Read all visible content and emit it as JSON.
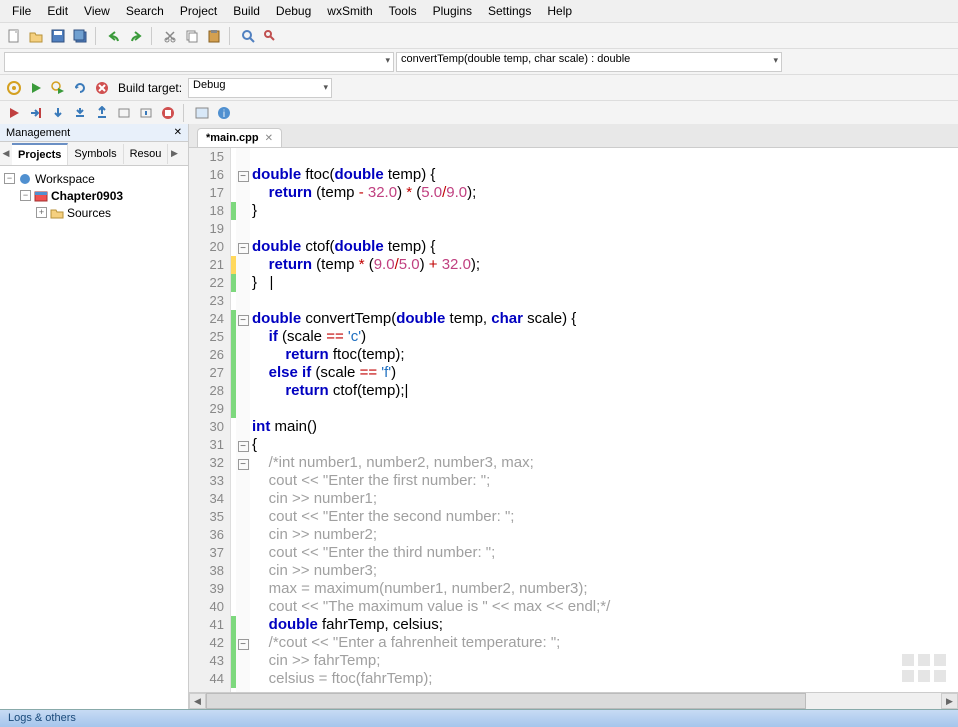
{
  "menubar": [
    "File",
    "Edit",
    "View",
    "Search",
    "Project",
    "Build",
    "Debug",
    "wxSmith",
    "Tools",
    "Plugins",
    "Settings",
    "Help"
  ],
  "toolbar2": {
    "function_dropdown": "convertTemp(double temp, char scale) : double"
  },
  "toolbar3": {
    "build_target_label": "Build target:",
    "build_target_value": "Debug"
  },
  "management": {
    "title": "Management",
    "tabs": [
      "Projects",
      "Symbols",
      "Resou"
    ],
    "active_tab": 0,
    "tree": {
      "workspace": "Workspace",
      "project": "Chapter0903",
      "folder": "Sources"
    }
  },
  "editor": {
    "tab_title": "*main.cpp",
    "first_line": 15,
    "lines": [
      {
        "num": 15,
        "change": "",
        "fold": "",
        "tokens": []
      },
      {
        "num": 16,
        "change": "",
        "fold": "-",
        "tokens": [
          [
            "kw",
            "double"
          ],
          [
            "",
            " ftoc("
          ],
          [
            "kw",
            "double"
          ],
          [
            "",
            " temp) {"
          ]
        ]
      },
      {
        "num": 17,
        "change": "",
        "fold": "",
        "tokens": [
          [
            "",
            "    "
          ],
          [
            "kw",
            "return"
          ],
          [
            "",
            " (temp "
          ],
          [
            "op",
            "-"
          ],
          [
            "",
            " "
          ],
          [
            "num",
            "32.0"
          ],
          [
            "",
            ") "
          ],
          [
            "op",
            "*"
          ],
          [
            "",
            " ("
          ],
          [
            "num",
            "5.0"
          ],
          [
            "op",
            "/"
          ],
          [
            "num",
            "9.0"
          ],
          [
            "",
            ");"
          ]
        ]
      },
      {
        "num": 18,
        "change": "new",
        "fold": "",
        "tokens": [
          [
            "",
            "}"
          ]
        ]
      },
      {
        "num": 19,
        "change": "",
        "fold": "",
        "tokens": []
      },
      {
        "num": 20,
        "change": "",
        "fold": "-",
        "tokens": [
          [
            "kw",
            "double"
          ],
          [
            "",
            " ctof("
          ],
          [
            "kw",
            "double"
          ],
          [
            "",
            " temp) {"
          ]
        ]
      },
      {
        "num": 21,
        "change": "mod",
        "fold": "",
        "tokens": [
          [
            "",
            "    "
          ],
          [
            "kw",
            "return"
          ],
          [
            "",
            " (temp "
          ],
          [
            "op",
            "*"
          ],
          [
            "",
            " ("
          ],
          [
            "num",
            "9.0"
          ],
          [
            "op",
            "/"
          ],
          [
            "num",
            "5.0"
          ],
          [
            "",
            ") "
          ],
          [
            "op",
            "+"
          ],
          [
            "",
            " "
          ],
          [
            "num",
            "32.0"
          ],
          [
            "",
            ");"
          ]
        ]
      },
      {
        "num": 22,
        "change": "new",
        "fold": "",
        "tokens": [
          [
            "",
            "}   "
          ],
          [
            "",
            "|"
          ]
        ]
      },
      {
        "num": 23,
        "change": "",
        "fold": "",
        "tokens": []
      },
      {
        "num": 24,
        "change": "new",
        "fold": "-",
        "tokens": [
          [
            "kw",
            "double"
          ],
          [
            "",
            " convertTemp("
          ],
          [
            "kw",
            "double"
          ],
          [
            "",
            " temp, "
          ],
          [
            "kw",
            "char"
          ],
          [
            "",
            " scale) {"
          ]
        ]
      },
      {
        "num": 25,
        "change": "new",
        "fold": "",
        "tokens": [
          [
            "",
            "    "
          ],
          [
            "kw",
            "if"
          ],
          [
            "",
            " (scale "
          ],
          [
            "op",
            "=="
          ],
          [
            "",
            " "
          ],
          [
            "str",
            "'c'"
          ],
          [
            "",
            ")"
          ]
        ]
      },
      {
        "num": 26,
        "change": "new",
        "fold": "",
        "tokens": [
          [
            "",
            "        "
          ],
          [
            "kw",
            "return"
          ],
          [
            "",
            " ftoc(temp);"
          ]
        ]
      },
      {
        "num": 27,
        "change": "new",
        "fold": "",
        "tokens": [
          [
            "",
            "    "
          ],
          [
            "kw",
            "else if"
          ],
          [
            "",
            " (scale "
          ],
          [
            "op",
            "=="
          ],
          [
            "",
            " "
          ],
          [
            "str",
            "'f'"
          ],
          [
            "",
            ")"
          ]
        ]
      },
      {
        "num": 28,
        "change": "new",
        "fold": "",
        "tokens": [
          [
            "",
            "        "
          ],
          [
            "kw",
            "return"
          ],
          [
            "",
            " ctof(temp);"
          ],
          [
            "",
            "|"
          ]
        ]
      },
      {
        "num": 29,
        "change": "new",
        "fold": "",
        "tokens": []
      },
      {
        "num": 30,
        "change": "",
        "fold": "",
        "tokens": [
          [
            "kw",
            "int"
          ],
          [
            "",
            " main()"
          ]
        ]
      },
      {
        "num": 31,
        "change": "",
        "fold": "-",
        "tokens": [
          [
            "",
            "{"
          ]
        ]
      },
      {
        "num": 32,
        "change": "",
        "fold": "-",
        "tokens": [
          [
            "cmt",
            "    /*int number1, number2, number3, max;"
          ]
        ]
      },
      {
        "num": 33,
        "change": "",
        "fold": "",
        "tokens": [
          [
            "cmt",
            "    cout << \"Enter the first number: \";"
          ]
        ]
      },
      {
        "num": 34,
        "change": "",
        "fold": "",
        "tokens": [
          [
            "cmt",
            "    cin >> number1;"
          ]
        ]
      },
      {
        "num": 35,
        "change": "",
        "fold": "",
        "tokens": [
          [
            "cmt",
            "    cout << \"Enter the second number: \";"
          ]
        ]
      },
      {
        "num": 36,
        "change": "",
        "fold": "",
        "tokens": [
          [
            "cmt",
            "    cin >> number2;"
          ]
        ]
      },
      {
        "num": 37,
        "change": "",
        "fold": "",
        "tokens": [
          [
            "cmt",
            "    cout << \"Enter the third number: \";"
          ]
        ]
      },
      {
        "num": 38,
        "change": "",
        "fold": "",
        "tokens": [
          [
            "cmt",
            "    cin >> number3;"
          ]
        ]
      },
      {
        "num": 39,
        "change": "",
        "fold": "",
        "tokens": [
          [
            "cmt",
            "    max = maximum(number1, number2, number3);"
          ]
        ]
      },
      {
        "num": 40,
        "change": "",
        "fold": "",
        "tokens": [
          [
            "cmt",
            "    cout << \"The maximum value is \" << max << endl;*/"
          ]
        ]
      },
      {
        "num": 41,
        "change": "new",
        "fold": "",
        "tokens": [
          [
            "",
            "    "
          ],
          [
            "kw",
            "double"
          ],
          [
            "",
            " fahrTemp, celsius;"
          ]
        ]
      },
      {
        "num": 42,
        "change": "new",
        "fold": "-",
        "tokens": [
          [
            "cmt",
            "    /*cout << \"Enter a fahrenheit temperature: \";"
          ]
        ]
      },
      {
        "num": 43,
        "change": "new",
        "fold": "",
        "tokens": [
          [
            "cmt",
            "    cin >> fahrTemp;"
          ]
        ]
      },
      {
        "num": 44,
        "change": "new",
        "fold": "",
        "tokens": [
          [
            "cmt",
            "    celsius = ftoc(fahrTemp);"
          ]
        ]
      }
    ]
  },
  "bottom_bar": "Logs & others"
}
